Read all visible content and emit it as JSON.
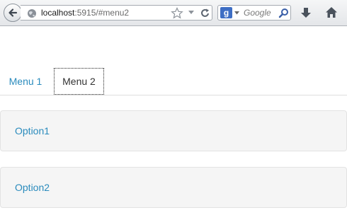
{
  "browser": {
    "url_host": "localhost",
    "url_rest": ":5915/#menu2",
    "search_placeholder": "Google",
    "search_engine_letter": "g"
  },
  "tabs": [
    {
      "label": "Menu 1",
      "active": false
    },
    {
      "label": "Menu 2",
      "active": true
    }
  ],
  "options": [
    {
      "label": "Option1"
    },
    {
      "label": "Option2"
    }
  ],
  "colors": {
    "link": "#2a8bbd",
    "panel_bg": "#f5f5f5",
    "panel_border": "#e3e3e3"
  }
}
